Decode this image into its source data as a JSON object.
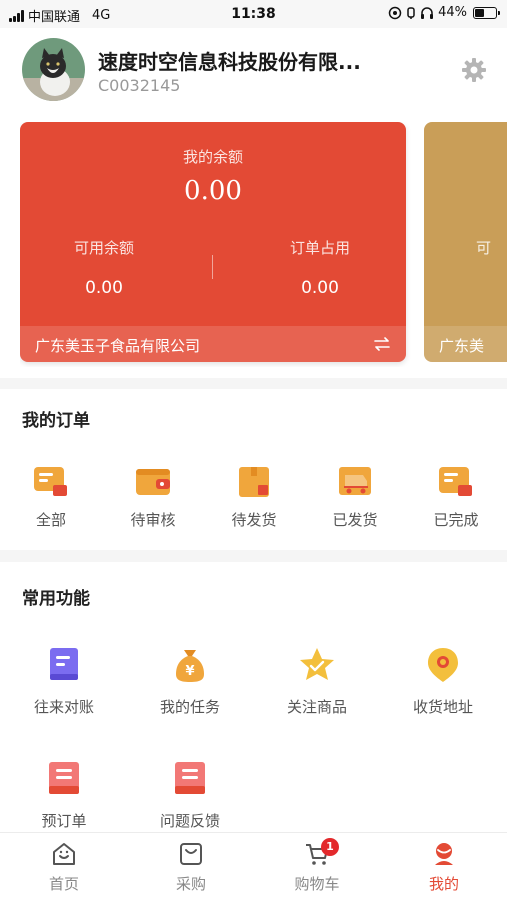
{
  "status_bar": {
    "carrier": "中国联通",
    "network": "4G",
    "time": "11:38",
    "battery": "44%"
  },
  "profile": {
    "company_name": "速度时空信息科技股份有限...",
    "account_code": "C0032145"
  },
  "balance_card": {
    "my_balance_label": "我的余额",
    "my_balance_value": "0.00",
    "available_label": "可用余额",
    "available_value": "0.00",
    "occupied_label": "订单占用",
    "occupied_value": "0.00",
    "supplier": "广东美玉子食品有限公司"
  },
  "second_card": {
    "partial_label": "可",
    "partial_supplier": "广东美"
  },
  "orders": {
    "title": "我的订单",
    "items": [
      {
        "label": "全部",
        "icon": "all-orders-icon"
      },
      {
        "label": "待审核",
        "icon": "wallet-icon"
      },
      {
        "label": "待发货",
        "icon": "box-icon"
      },
      {
        "label": "已发货",
        "icon": "truck-icon"
      },
      {
        "label": "已完成",
        "icon": "completed-icon"
      }
    ]
  },
  "functions": {
    "title": "常用功能",
    "items": [
      {
        "label": "往来对账",
        "icon": "ledger-icon"
      },
      {
        "label": "我的任务",
        "icon": "money-bag-icon"
      },
      {
        "label": "关注商品",
        "icon": "star-icon"
      },
      {
        "label": "收货地址",
        "icon": "location-icon"
      },
      {
        "label": "预订单",
        "icon": "preorder-icon"
      },
      {
        "label": "问题反馈",
        "icon": "feedback-icon"
      }
    ]
  },
  "tabbar": {
    "items": [
      {
        "label": "首页",
        "icon": "home-icon"
      },
      {
        "label": "采购",
        "icon": "purchase-icon"
      },
      {
        "label": "购物车",
        "icon": "cart-icon",
        "badge": "1"
      },
      {
        "label": "我的",
        "icon": "profile-icon"
      }
    ],
    "active_color": "#e34a35"
  },
  "colors": {
    "accent": "#e34a35",
    "card_secondary": "#c99e58",
    "icon_orange": "#f0a63c"
  }
}
